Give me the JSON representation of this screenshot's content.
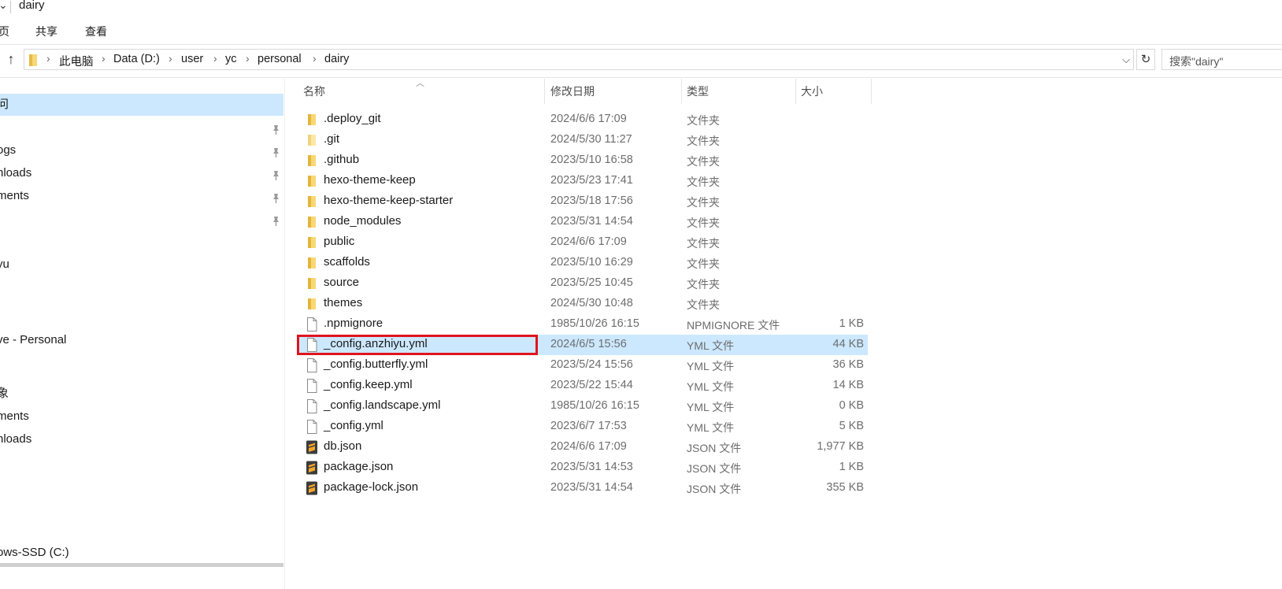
{
  "window": {
    "title": "dairy"
  },
  "ribbon": {
    "tabs": [
      "页",
      "共享",
      "查看"
    ]
  },
  "address": {
    "crumbs": [
      "此电脑",
      "Data (D:)",
      "user",
      "yc",
      "personal",
      "dairy"
    ]
  },
  "search": {
    "placeholder": "搜索\"dairy\""
  },
  "nav": {
    "items": [
      {
        "label": "问",
        "selected": true,
        "pinned": false
      },
      {
        "label": "",
        "selected": false,
        "pinned": true
      },
      {
        "label": "ogs",
        "selected": false,
        "pinned": true
      },
      {
        "label": "nloads",
        "selected": false,
        "pinned": true
      },
      {
        "label": "ments",
        "selected": false,
        "pinned": true
      },
      {
        "label": "",
        "selected": false,
        "pinned": true
      },
      {
        "label": "yu",
        "selected": false,
        "pinned": false
      },
      {
        "label": "ve - Personal",
        "selected": false,
        "pinned": false
      },
      {
        "label": "象",
        "selected": false,
        "pinned": false
      },
      {
        "label": "ments",
        "selected": false,
        "pinned": false
      },
      {
        "label": "nloads",
        "selected": false,
        "pinned": false
      },
      {
        "label": "ows-SSD (C:)",
        "selected": false,
        "pinned": false
      }
    ]
  },
  "columns": {
    "name": "名称",
    "date": "修改日期",
    "type": "类型",
    "size": "大小"
  },
  "files": [
    {
      "name": ".deploy_git",
      "date": "2024/6/6 17:09",
      "type": "文件夹",
      "size": "",
      "icon": "folder"
    },
    {
      "name": ".git",
      "date": "2024/5/30 11:27",
      "type": "文件夹",
      "size": "",
      "icon": "folder-light"
    },
    {
      "name": ".github",
      "date": "2023/5/10 16:58",
      "type": "文件夹",
      "size": "",
      "icon": "folder"
    },
    {
      "name": "hexo-theme-keep",
      "date": "2023/5/23 17:41",
      "type": "文件夹",
      "size": "",
      "icon": "folder"
    },
    {
      "name": "hexo-theme-keep-starter",
      "date": "2023/5/18 17:56",
      "type": "文件夹",
      "size": "",
      "icon": "folder"
    },
    {
      "name": "node_modules",
      "date": "2023/5/31 14:54",
      "type": "文件夹",
      "size": "",
      "icon": "folder"
    },
    {
      "name": "public",
      "date": "2024/6/6 17:09",
      "type": "文件夹",
      "size": "",
      "icon": "folder"
    },
    {
      "name": "scaffolds",
      "date": "2023/5/10 16:29",
      "type": "文件夹",
      "size": "",
      "icon": "folder"
    },
    {
      "name": "source",
      "date": "2023/5/25 10:45",
      "type": "文件夹",
      "size": "",
      "icon": "folder"
    },
    {
      "name": "themes",
      "date": "2024/5/30 10:48",
      "type": "文件夹",
      "size": "",
      "icon": "folder"
    },
    {
      "name": ".npmignore",
      "date": "1985/10/26 16:15",
      "type": "NPMIGNORE 文件",
      "size": "1 KB",
      "icon": "file"
    },
    {
      "name": "_config.anzhiyu.yml",
      "date": "2024/6/5 15:56",
      "type": "YML 文件",
      "size": "44 KB",
      "icon": "file",
      "selected": true
    },
    {
      "name": "_config.butterfly.yml",
      "date": "2023/5/24 15:56",
      "type": "YML 文件",
      "size": "36 KB",
      "icon": "file"
    },
    {
      "name": "_config.keep.yml",
      "date": "2023/5/22 15:44",
      "type": "YML 文件",
      "size": "14 KB",
      "icon": "file"
    },
    {
      "name": "_config.landscape.yml",
      "date": "1985/10/26 16:15",
      "type": "YML 文件",
      "size": "0 KB",
      "icon": "file"
    },
    {
      "name": "_config.yml",
      "date": "2023/6/7 17:53",
      "type": "YML 文件",
      "size": "5 KB",
      "icon": "file"
    },
    {
      "name": "db.json",
      "date": "2024/6/6 17:09",
      "type": "JSON 文件",
      "size": "1,977 KB",
      "icon": "sublime"
    },
    {
      "name": "package.json",
      "date": "2023/5/31 14:53",
      "type": "JSON 文件",
      "size": "1 KB",
      "icon": "sublime"
    },
    {
      "name": "package-lock.json",
      "date": "2023/5/31 14:54",
      "type": "JSON 文件",
      "size": "355 KB",
      "icon": "sublime"
    }
  ],
  "colors": {
    "selection": "#cce8ff",
    "highlight_box": "#e0141d",
    "folder": "#f8d775"
  }
}
